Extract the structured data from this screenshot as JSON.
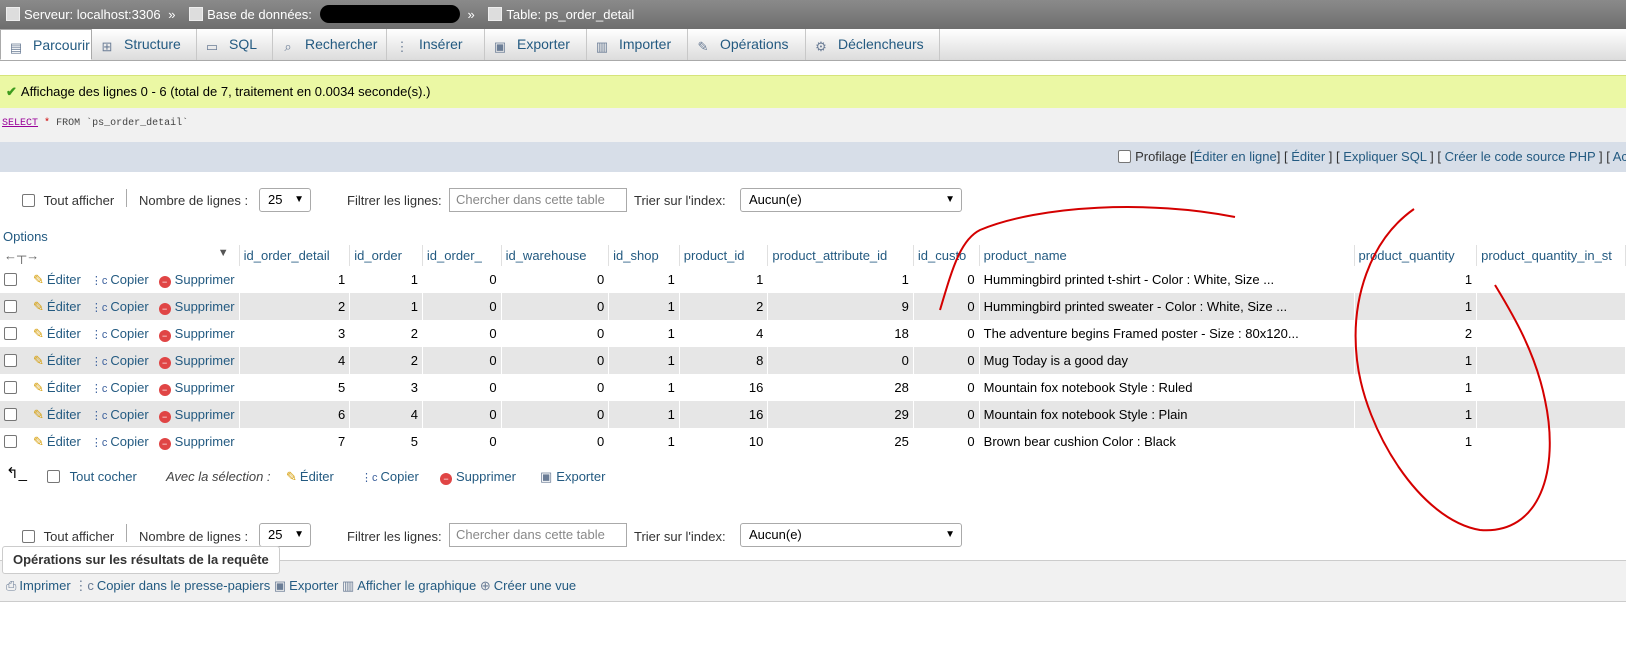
{
  "breadcrumb": {
    "server": "Serveur: localhost:3306",
    "sep": "»",
    "database": "Base de données:",
    "table": "Table: ps_order_detail"
  },
  "tabs": [
    {
      "label": "Parcourir",
      "icon": "browse-icon"
    },
    {
      "label": "Structure",
      "icon": "structure-icon"
    },
    {
      "label": "SQL",
      "icon": "sql-icon"
    },
    {
      "label": "Rechercher",
      "icon": "search-icon"
    },
    {
      "label": "Insérer",
      "icon": "insert-icon"
    },
    {
      "label": "Exporter",
      "icon": "export-icon"
    },
    {
      "label": "Importer",
      "icon": "import-icon"
    },
    {
      "label": "Opérations",
      "icon": "wrench-icon"
    },
    {
      "label": "Déclencheurs",
      "icon": "trigger-icon"
    }
  ],
  "message": "Affichage des lignes 0 - 6 (total de 7, traitement en 0.0034 seconde(s).)",
  "sql": {
    "select": "SELECT",
    "star": "*",
    "rest": "FROM `ps_order_detail`"
  },
  "profiling": {
    "label": "Profilage",
    "links": [
      "Éditer en ligne",
      "Éditer",
      "Expliquer SQL",
      "Créer le code source PHP",
      "Actua"
    ]
  },
  "nav": {
    "show_all": "Tout afficher",
    "rows_label": "Nombre de lignes :",
    "rows_value": "25",
    "filter_label": "Filtrer les lignes:",
    "filter_placeholder": "Chercher dans cette table",
    "sort_label": "Trier sur l'index:",
    "sort_value": "Aucun(e)"
  },
  "options_label": "Options",
  "columns": [
    "id_order_detail",
    "id_order",
    "id_order_",
    "id_warehouse",
    "id_shop",
    "product_id",
    "product_attribute_id",
    "id_custo",
    "product_name",
    "product_quantity",
    "product_quantity_in_st"
  ],
  "actions": {
    "edit": "Éditer",
    "copy": "Copier",
    "delete": "Supprimer"
  },
  "rows": [
    [
      "1",
      "1",
      "0",
      "0",
      "1",
      "1",
      "1",
      "0",
      "Hummingbird printed t-shirt - Color : White, Size ...",
      "1",
      ""
    ],
    [
      "2",
      "1",
      "0",
      "0",
      "1",
      "2",
      "9",
      "0",
      "Hummingbird printed sweater - Color : White, Size ...",
      "1",
      ""
    ],
    [
      "3",
      "2",
      "0",
      "0",
      "1",
      "4",
      "18",
      "0",
      "The adventure begins Framed poster - Size : 80x120...",
      "2",
      ""
    ],
    [
      "4",
      "2",
      "0",
      "0",
      "1",
      "8",
      "0",
      "0",
      "Mug Today is a good day",
      "1",
      ""
    ],
    [
      "5",
      "3",
      "0",
      "0",
      "1",
      "16",
      "28",
      "0",
      "Mountain fox notebook Style : Ruled",
      "1",
      ""
    ],
    [
      "6",
      "4",
      "0",
      "0",
      "1",
      "16",
      "29",
      "0",
      "Mountain fox notebook Style : Plain",
      "1",
      ""
    ],
    [
      "7",
      "5",
      "0",
      "0",
      "1",
      "10",
      "25",
      "0",
      "Brown bear cushion Color : Black",
      "1",
      ""
    ]
  ],
  "bulk": {
    "check_all": "Tout cocher",
    "with_selection": "Avec la sélection :",
    "edit": "Éditer",
    "copy": "Copier",
    "delete": "Supprimer",
    "export": "Exporter"
  },
  "query_ops": {
    "legend": "Opérations sur les résultats de la requête",
    "links": [
      "Imprimer",
      "Copier dans le presse-papiers",
      "Exporter",
      "Afficher le graphique",
      "Créer une vue"
    ]
  },
  "colors": {
    "accent": "#235a81",
    "success_bg": "#ebf8a4",
    "annotation": "#d40000"
  }
}
